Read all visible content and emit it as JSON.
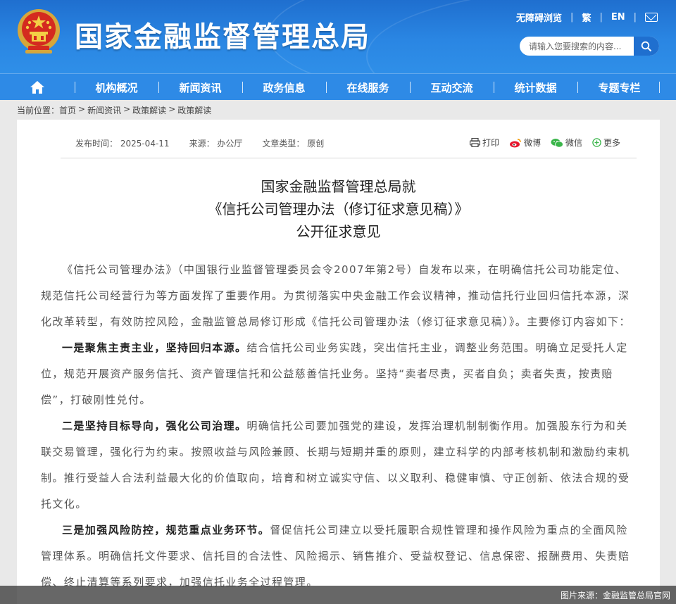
{
  "header": {
    "site_title": "国家金融监督管理总局",
    "accessibility_label": "无障碍浏览",
    "traditional_label": "繁",
    "english_label": "EN",
    "search_placeholder": "请输入您要搜索的内容...",
    "colors": {
      "brand_blue": "#1f6fcf",
      "nav_blue": "#2e8ae6"
    }
  },
  "nav": {
    "home_icon": "home-icon",
    "items": [
      "机构概况",
      "新闻资讯",
      "政务信息",
      "在线服务",
      "互动交流",
      "统计数据",
      "专题专栏"
    ]
  },
  "breadcrumb": {
    "prefix": "当前位置：",
    "items": [
      "首页",
      "新闻资讯",
      "政策解读",
      "政策解读"
    ]
  },
  "article": {
    "publish_time": "发布时间：  2025-04-11",
    "source": "来源：  办公厅",
    "type": "文章类型：  原创",
    "share": {
      "print": "打印",
      "weibo": "微博",
      "wechat": "微信",
      "more": "更多"
    },
    "title_line1": "国家金融监督管理总局就",
    "title_line2": "《信托公司管理办法（修订征求意见稿）》",
    "title_line3": "公开征求意见",
    "p1": "《信托公司管理办法》（中国银行业监督管理委员会令2007年第2号）自发布以来，在明确信托公司功能定位、规范信托公司经营行为等方面发挥了重要作用。为贯彻落实中央金融工作会议精神，推动信托行业回归信托本源，深化改革转型，有效防控风险，金融监管总局修订形成《信托公司管理办法（修订征求意见稿）》。主要修订内容如下：",
    "p2_bold": "一是聚焦主责主业，坚持回归本源。",
    "p2_text": "结合信托公司业务实践，突出信托主业，调整业务范围。明确立足受托人定位，规范开展资产服务信托、资产管理信托和公益慈善信托业务。坚持“卖者尽责，买者自负；卖者失责，按责赔偿”，打破刚性兑付。",
    "p3_bold": "二是坚持目标导向，强化公司治理。",
    "p3_text": "明确信托公司要加强党的建设，发挥治理机制制衡作用。加强股东行为和关联交易管理，强化行为约束。按照收益与风险兼顾、长期与短期并重的原则，建立科学的内部考核机制和激励约束机制。推行受益人合法利益最大化的价值取向，培育和树立诚实守信、以义取利、稳健审慎、守正创新、依法合规的受托文化。",
    "p4_bold": "三是加强风险防控，规范重点业务环节。",
    "p4_text": "督促信托公司建立以受托履职合规性管理和操作风险为重点的全面风险管理体系。明确信托文件要求、信托目的合法性、风险揭示、销售推介、受益权登记、信息保密、报酬费用、失责赔偿、终止清算等系列要求，加强信托业务全过程管理。"
  },
  "caption": "图片来源：金融监管总局官网"
}
